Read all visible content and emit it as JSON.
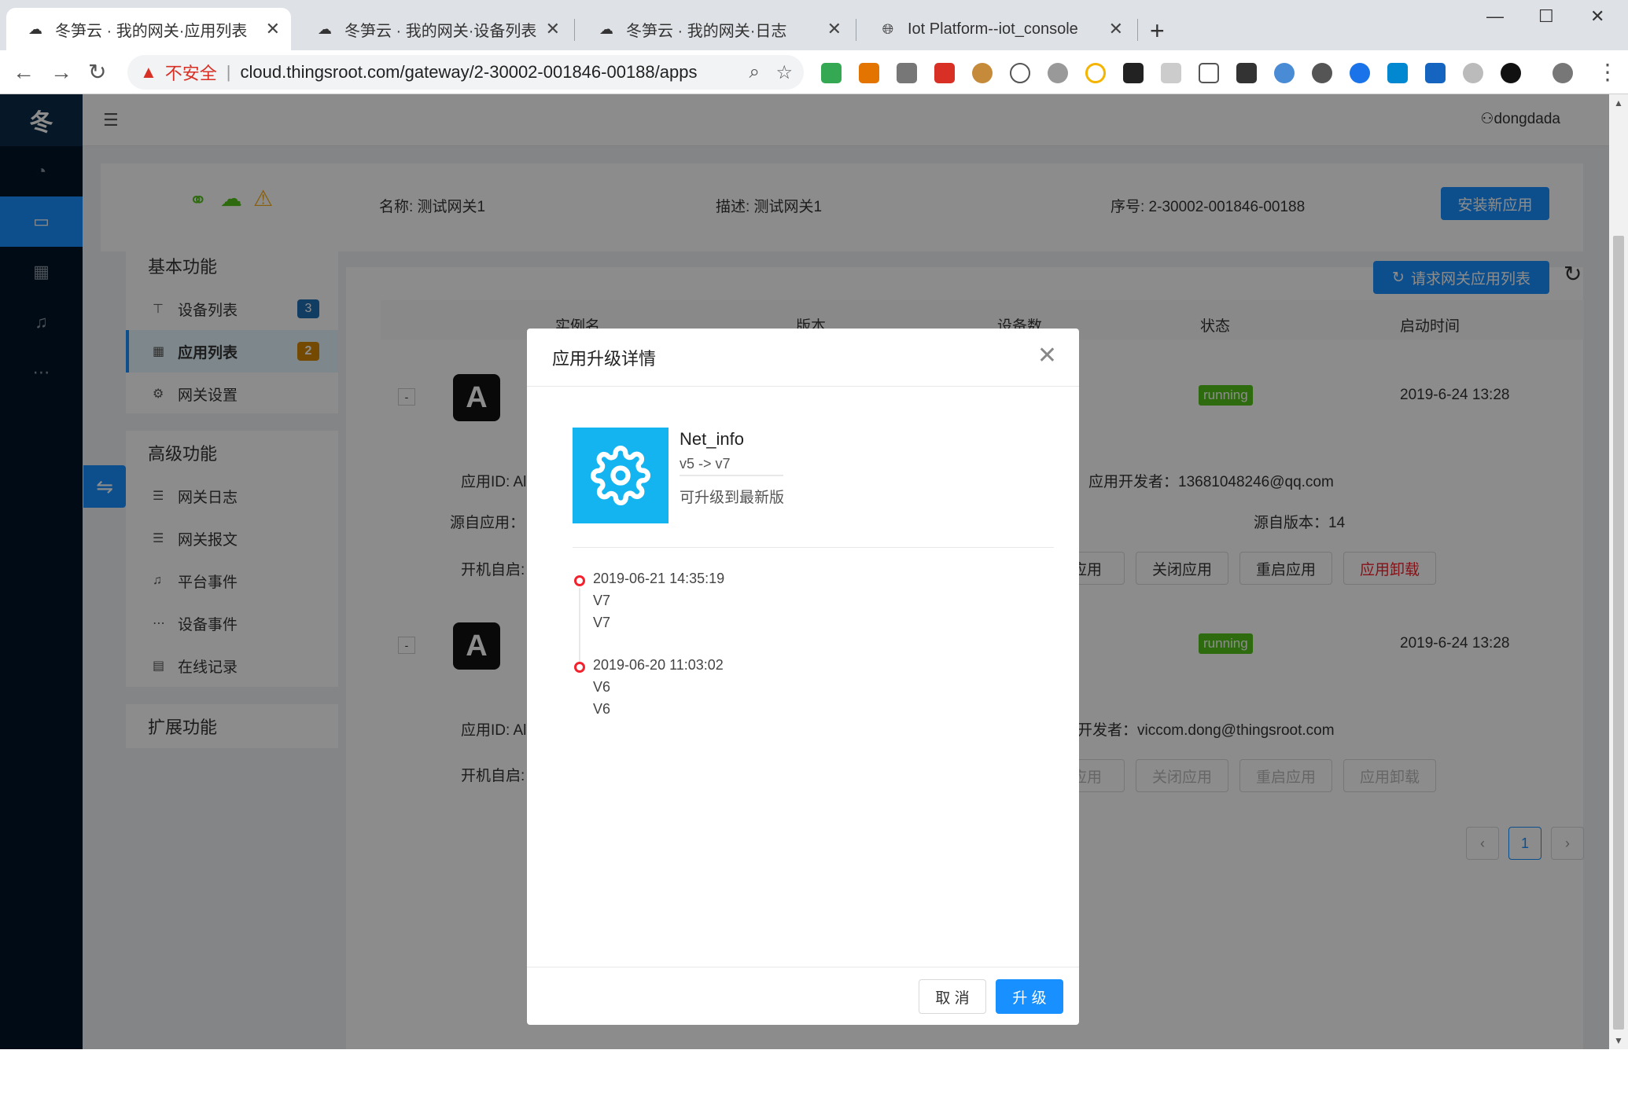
{
  "browser": {
    "tabs": [
      {
        "label": "冬笋云 · 我的网关·应用列表",
        "active": true
      },
      {
        "label": "冬笋云 · 我的网关·设备列表",
        "active": false
      },
      {
        "label": "冬笋云 · 我的网关·日志",
        "active": false
      },
      {
        "label": "Iot Platform--iot_console",
        "active": false
      }
    ],
    "insecure_label": "不安全",
    "url": "cloud.thingsroot.com/gateway/2-30002-001846-00188/apps"
  },
  "sidebar": {
    "logo": "冬"
  },
  "header": {
    "user": "dongdada"
  },
  "gateway": {
    "name": "名称: 测试网关1",
    "desc": "描述: 测试网关1",
    "serial": "序号: 2-30002-001846-00188",
    "install_label": "安装新应用"
  },
  "menu": {
    "basic_title": "基本功能",
    "basic_items": [
      {
        "label": "设备列表",
        "badge": "3",
        "badge_color": "#1f6fb5"
      },
      {
        "label": "应用列表",
        "badge": "2",
        "badge_color": "#d48806"
      },
      {
        "label": "网关设置"
      }
    ],
    "advanced_title": "高级功能",
    "advanced_items": [
      {
        "label": "网关日志"
      },
      {
        "label": "网关报文"
      },
      {
        "label": "平台事件"
      },
      {
        "label": "设备事件"
      },
      {
        "label": "在线记录"
      }
    ],
    "ext_title": "扩展功能"
  },
  "apps": {
    "request_label": "请求网关应用列表",
    "columns": [
      "实例名",
      "版本",
      "设备数",
      "状态",
      "启动时间"
    ],
    "rows": [
      {
        "icon_letter": "A",
        "status": "running",
        "start_time": "2019-6-24 13:28",
        "app_id": "应用ID: Al",
        "source_app": "源自应用：",
        "autostart": "开机自启:",
        "developer": "应用开发者：13681048246@qq.com",
        "source_version": "源自版本：14",
        "actions": [
          "应用",
          "关闭应用",
          "重启应用",
          "应用卸载"
        ]
      },
      {
        "icon_letter": "A",
        "status": "running",
        "start_time": "2019-6-24 13:28",
        "app_id": "应用ID: Al",
        "autostart": "开机自启:",
        "developer": "开发者：viccom.dong@thingsroot.com",
        "actions": [
          "应用",
          "关闭应用",
          "重启应用",
          "应用卸载"
        ]
      }
    ],
    "page": "1"
  },
  "modal": {
    "title": "应用升级详情",
    "app_name": "Net_info",
    "version_change": "v5 -> v7",
    "note": "可升级到最新版",
    "history": [
      {
        "date": "2019-06-21 14:35:19",
        "lines": [
          "V7",
          "V7"
        ]
      },
      {
        "date": "2019-06-20 11:03:02",
        "lines": [
          "V6",
          "V6"
        ]
      }
    ],
    "cancel_label": "取 消",
    "ok_label": "升 级"
  }
}
